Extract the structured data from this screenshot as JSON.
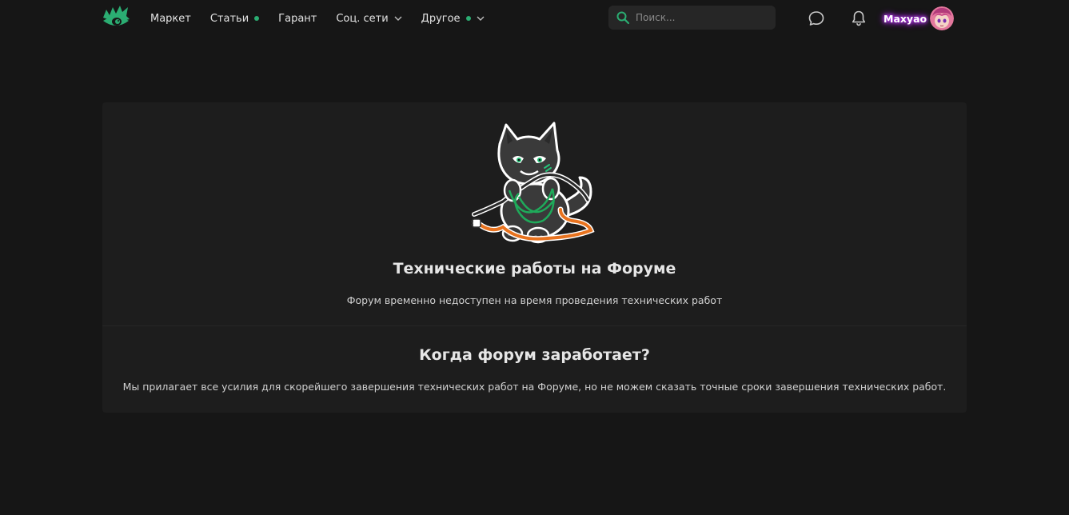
{
  "nav": {
    "items": [
      {
        "label": "Маркет",
        "dot": false,
        "dropdown": false
      },
      {
        "label": "Статьи",
        "dot": true,
        "dropdown": false
      },
      {
        "label": "Гарант",
        "dot": false,
        "dropdown": false
      },
      {
        "label": "Соц. сети",
        "dot": false,
        "dropdown": true
      },
      {
        "label": "Другое",
        "dot": true,
        "dropdown": true
      }
    ]
  },
  "search": {
    "placeholder": "Поиск..."
  },
  "user": {
    "name": "Maxyao"
  },
  "maintenance": {
    "title": "Технические работы на Форуме",
    "description": "Форум временно недоступен на время проведения технических работ"
  },
  "eta": {
    "title": "Когда форум заработает?",
    "description": "Мы прилагает все усилия для скорейшего завершения технических работ на Форуме, но не можем сказать точные сроки завершения технических работ."
  },
  "colors": {
    "background": "#161616",
    "card": "#1d1d1d",
    "accent": "#2bad72",
    "username_glow": "#c43cff"
  },
  "icons": [
    "logo-eye-icon",
    "chevron-down-icon",
    "search-icon",
    "chat-icon",
    "bell-icon"
  ]
}
